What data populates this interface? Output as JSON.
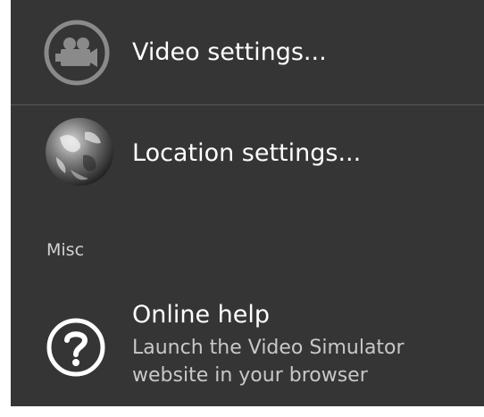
{
  "settings": {
    "video": {
      "title": "Video settings...",
      "icon": "video-camera-icon"
    },
    "location": {
      "title": "Location settings...",
      "icon": "globe-icon"
    }
  },
  "misc": {
    "category_label": "Misc",
    "online_help": {
      "title": "Online help",
      "summary": "Launch the Video Simulator website in your browser",
      "icon": "help-circle-icon"
    }
  },
  "colors": {
    "background": "#353535",
    "text_primary": "#ffffff",
    "text_secondary": "#c8c8c8",
    "divider": "#5a5a5a"
  }
}
